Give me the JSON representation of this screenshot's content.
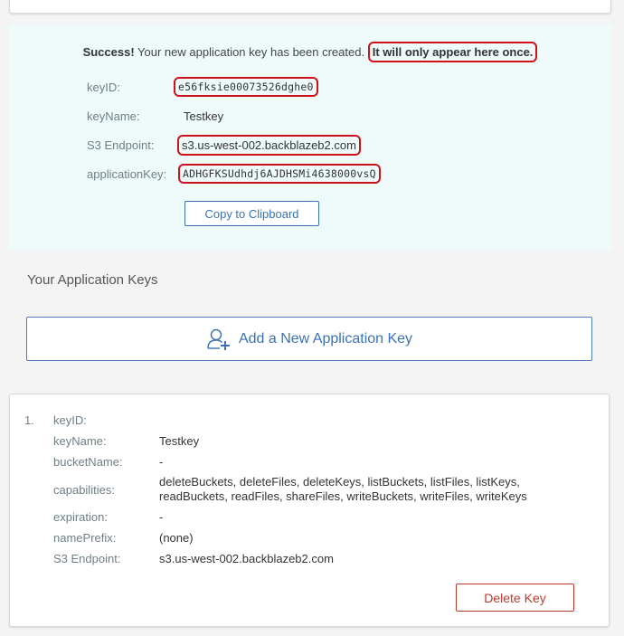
{
  "success": {
    "strong_prefix": "Success!",
    "message": "Your new application key has been created.",
    "warning": "It will only appear here once.",
    "fields": [
      {
        "label": "keyID:",
        "value": "e56fksie00073526dghe0"
      },
      {
        "label": "keyName:",
        "value": "Testkey"
      },
      {
        "label": "S3 Endpoint:",
        "value": "s3.us-west-002.backblazeb2.com"
      },
      {
        "label": "applicationKey:",
        "value": "ADHGFKSUdhdj6AJDHSMi4638000vsQ"
      }
    ],
    "copy_button": "Copy to Clipboard"
  },
  "keys_section": {
    "title": "Your Application Keys",
    "add_button": "Add a New Application Key"
  },
  "key_item": {
    "number": "1.",
    "rows": [
      {
        "label": "keyID:",
        "value": ""
      },
      {
        "label": "keyName:",
        "value": "Testkey"
      },
      {
        "label": "bucketName:",
        "value": "-"
      },
      {
        "label": "capabilities:",
        "value_line1": "deleteBuckets, deleteFiles, deleteKeys, listBuckets, listFiles, listKeys,",
        "value_line2": "readBuckets, readFiles, shareFiles, writeBuckets, writeFiles, writeKeys"
      },
      {
        "label": "expiration:",
        "value": "-"
      },
      {
        "label": "namePrefix:",
        "value": "(none)"
      },
      {
        "label": "S3 Endpoint:",
        "value": "s3.us-west-002.backblazeb2.com"
      }
    ],
    "delete_button": "Delete Key"
  },
  "colors": {
    "panel_bg": "#effbfb",
    "accent_blue": "#3a72b4",
    "highlight_red": "#d0101a",
    "delete_red": "#c0392b"
  }
}
